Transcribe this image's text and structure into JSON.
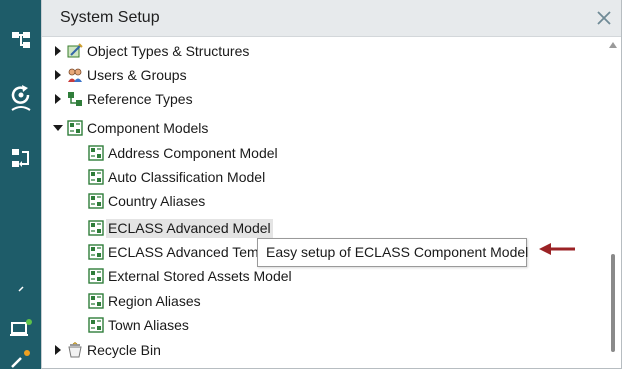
{
  "panel": {
    "title": "System Setup"
  },
  "tree": {
    "items": [
      {
        "label": "Object Types & Structures",
        "expanded": false,
        "icon": "object-types-icon"
      },
      {
        "label": "Users & Groups",
        "expanded": false,
        "icon": "users-groups-icon"
      },
      {
        "label": "Reference Types",
        "expanded": false,
        "icon": "reference-types-icon"
      },
      {
        "label": "Component Models",
        "expanded": true,
        "icon": "component-model-icon",
        "children": [
          {
            "label": "Address Component Model"
          },
          {
            "label": "Auto Classification Model"
          },
          {
            "label": "Country Aliases"
          },
          {
            "label": "ECLASS Advanced Model",
            "hovered": true
          },
          {
            "label": "ECLASS Advanced Temp"
          },
          {
            "label": "External Stored Assets Model"
          },
          {
            "label": "Region Aliases"
          },
          {
            "label": "Town Aliases"
          }
        ]
      },
      {
        "label": "Recycle Bin",
        "expanded": false,
        "icon": "recycle-bin-icon"
      }
    ]
  },
  "tooltip": {
    "text": "Easy setup of ECLASS Component Model"
  },
  "colors": {
    "sidebar": "#1e5c69",
    "header": "#e7eaec",
    "arrow": "#9b2225",
    "icon_green": "#2f7d3a"
  }
}
